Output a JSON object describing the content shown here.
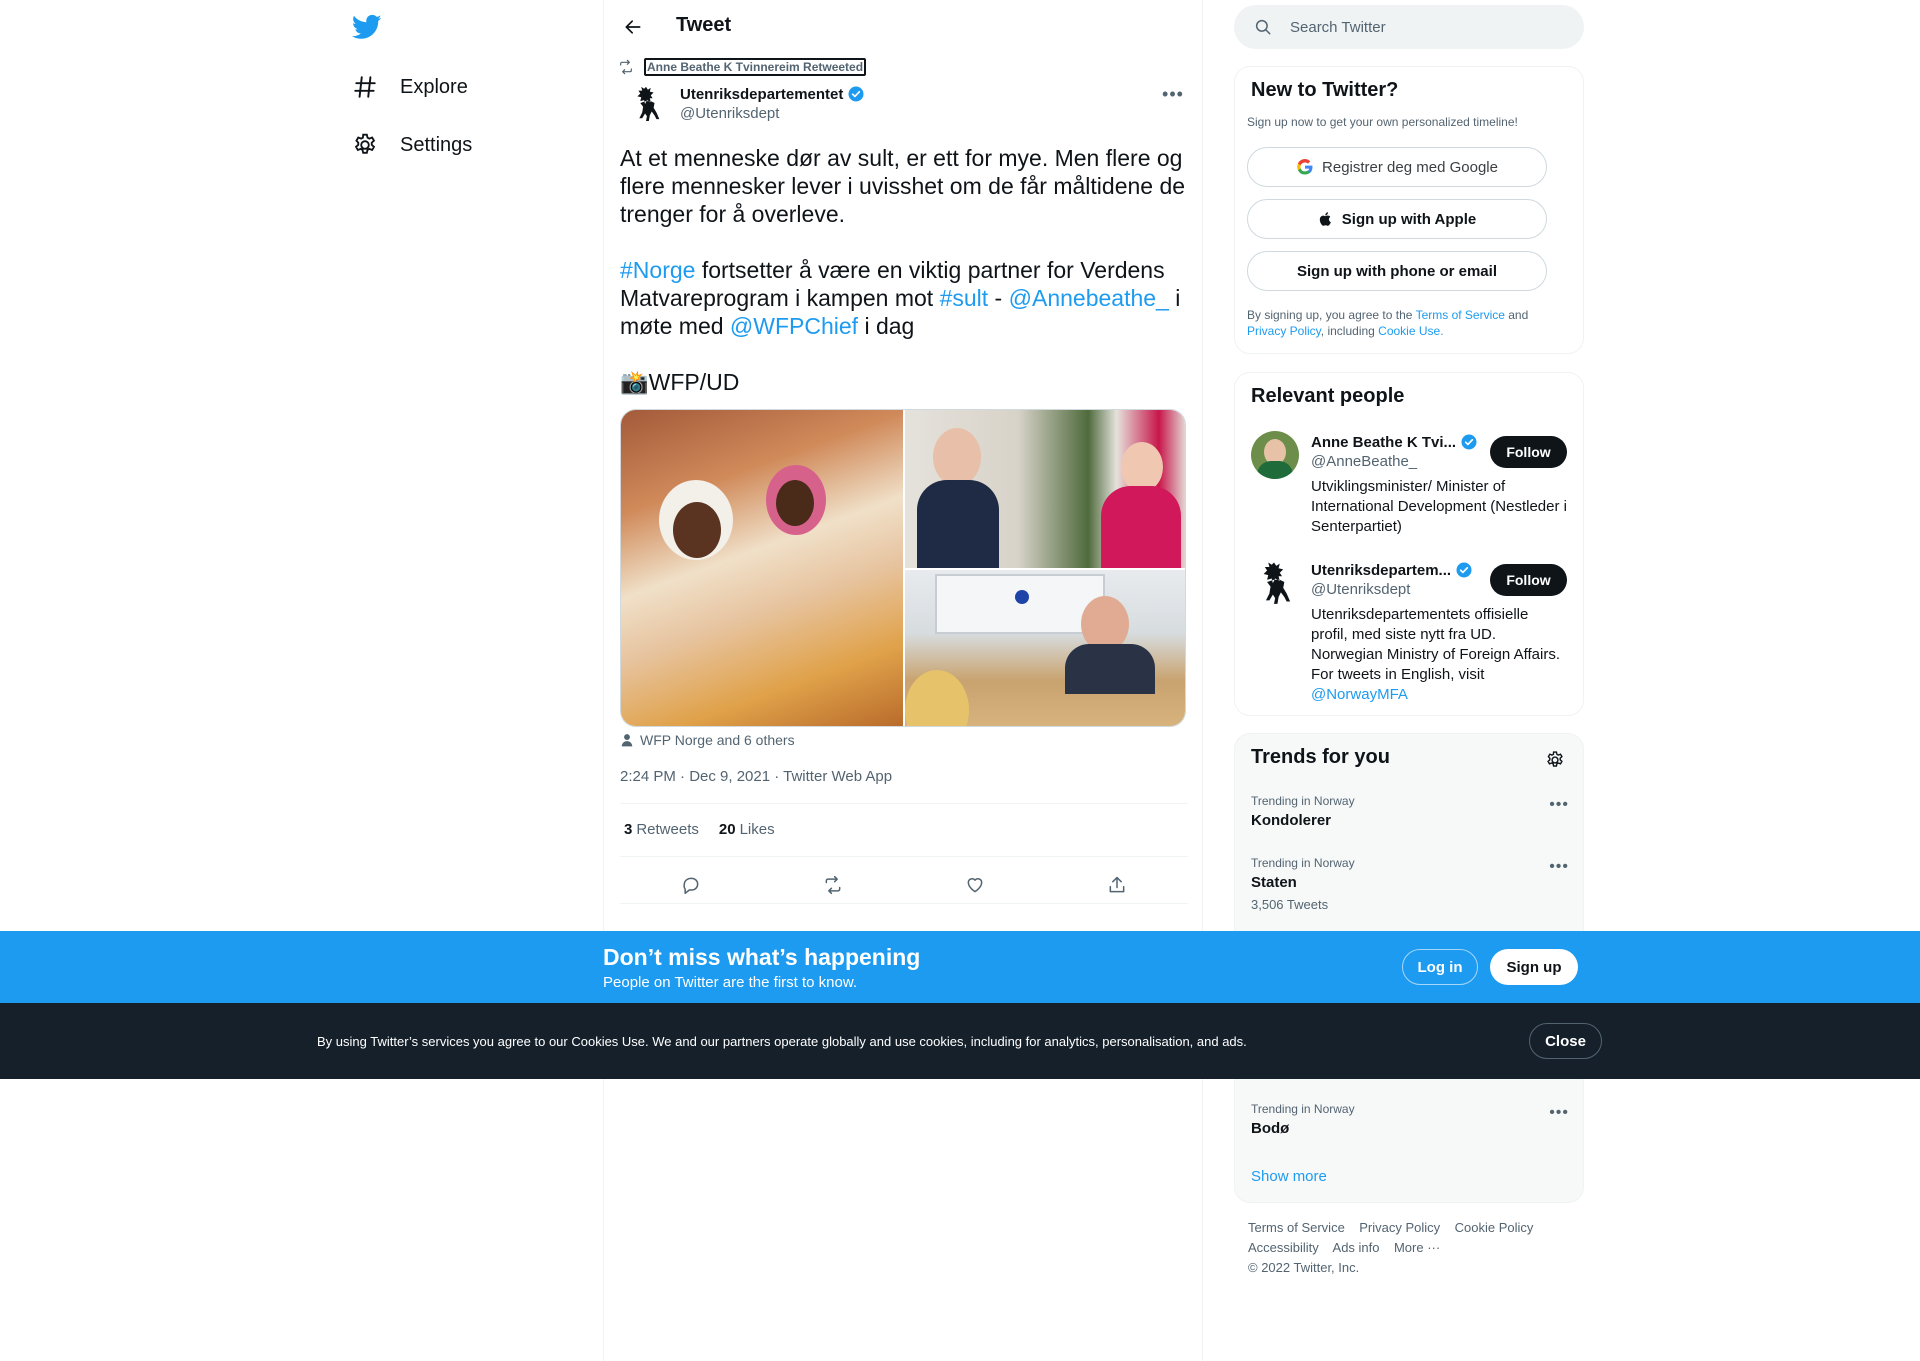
{
  "nav": {
    "explore_label": "Explore",
    "settings_label": "Settings"
  },
  "header": {
    "title": "Tweet"
  },
  "tweet": {
    "retweeted_by": "Anne Beathe K Tvinnereim Retweeted",
    "author_name": "Utenriksdepartementet",
    "author_handle": "@Utenriksdept",
    "paragraph1": "At et menneske dør av sult, er ett for mye. Men flere og flere mennesker lever i uvisshet om de får måltidene de trenger for å overleve.",
    "p2_hashtag1": "#Norge",
    "p2_text1": " fortsetter å være en viktig partner for Verdens Matvareprogram i kampen mot ",
    "p2_hashtag2": "#sult",
    "p2_text2": " -  ",
    "p2_mention1": "@Annebeathe_",
    "p2_text3": " i møte med ",
    "p2_mention2": "@WFPChief",
    "p2_text4": " i dag",
    "paragraph3": "📸WFP/UD",
    "liked_by": "WFP Norge and 6 others",
    "timestamp": "2:24 PM · Dec 9, 2021 · Twitter Web App",
    "retweets_count": "3",
    "retweets_label": "Retweets",
    "likes_count": "20",
    "likes_label": "Likes"
  },
  "search": {
    "placeholder": "Search Twitter"
  },
  "new_to_twitter": {
    "title": "New to Twitter?",
    "subtitle": "Sign up now to get your own personalized timeline!",
    "google_label": "Registrer deg med Google",
    "apple_label": "Sign up with Apple",
    "phone_label": "Sign up with phone or email",
    "terms_prefix": "By signing up, you agree to the ",
    "terms_link": "Terms of Service",
    "terms_and": " and ",
    "privacy_link": "Privacy Policy",
    "terms_including": ", including ",
    "cookie_link": "Cookie Use."
  },
  "relevant_people": {
    "title": "Relevant people",
    "people": [
      {
        "name": "Anne Beathe K Tvi...",
        "handle": "@AnneBeathe_",
        "bio": "Utviklingsminister/ Minister of International Development (Nestleder i Senterpartiet)",
        "follow_label": "Follow"
      },
      {
        "name": "Utenriksdepartem...",
        "handle": "@Utenriksdept",
        "bio": "Utenriksdepartementets offisielle profil, med siste nytt fra UD. Norwegian Ministry of Foreign Affairs. For tweets in English, visit ",
        "bio_link": "@NorwayMFA",
        "follow_label": "Follow"
      }
    ]
  },
  "trends": {
    "title": "Trends for you",
    "items": [
      {
        "meta": "Trending in Norway",
        "name": "Kondolerer",
        "count": ""
      },
      {
        "meta": "Trending in Norway",
        "name": "Staten",
        "count": "3,506 Tweets"
      },
      {
        "meta": "Trending in Norway",
        "name": "Bodø",
        "count": ""
      }
    ],
    "show_more": "Show more"
  },
  "footer": {
    "terms": "Terms of Service",
    "privacy": "Privacy Policy",
    "cookie": "Cookie Policy",
    "accessibility": "Accessibility",
    "ads": "Ads info",
    "more": "More ···",
    "copyright": "© 2022 Twitter, Inc."
  },
  "login_bar": {
    "title": "Don’t miss what’s happening",
    "subtitle": "People on Twitter are the first to know.",
    "login_label": "Log in",
    "signup_label": "Sign up"
  },
  "cookie_bar": {
    "text": "By using Twitter’s services you agree to our Cookies Use. We and our partners operate globally and use cookies, including for analytics, personalisation, and ads.",
    "close_label": "Close"
  },
  "colors": {
    "brand": "#1d9bf0",
    "text": "#0f1419",
    "muted": "#536471",
    "cookie_bg": "#15202b"
  }
}
